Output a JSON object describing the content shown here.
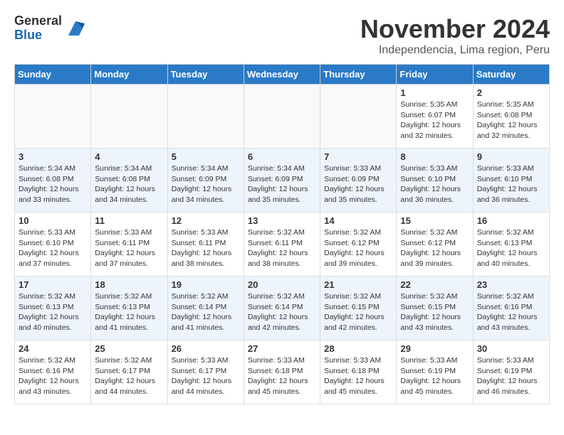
{
  "logo": {
    "general": "General",
    "blue": "Blue"
  },
  "title": "November 2024",
  "subtitle": "Independencia, Lima region, Peru",
  "headers": [
    "Sunday",
    "Monday",
    "Tuesday",
    "Wednesday",
    "Thursday",
    "Friday",
    "Saturday"
  ],
  "weeks": [
    {
      "days": [
        {
          "number": "",
          "info": ""
        },
        {
          "number": "",
          "info": ""
        },
        {
          "number": "",
          "info": ""
        },
        {
          "number": "",
          "info": ""
        },
        {
          "number": "",
          "info": ""
        },
        {
          "number": "1",
          "info": "Sunrise: 5:35 AM\nSunset: 6:07 PM\nDaylight: 12 hours and 32 minutes."
        },
        {
          "number": "2",
          "info": "Sunrise: 5:35 AM\nSunset: 6:08 PM\nDaylight: 12 hours and 32 minutes."
        }
      ]
    },
    {
      "days": [
        {
          "number": "3",
          "info": "Sunrise: 5:34 AM\nSunset: 6:08 PM\nDaylight: 12 hours and 33 minutes."
        },
        {
          "number": "4",
          "info": "Sunrise: 5:34 AM\nSunset: 6:08 PM\nDaylight: 12 hours and 34 minutes."
        },
        {
          "number": "5",
          "info": "Sunrise: 5:34 AM\nSunset: 6:09 PM\nDaylight: 12 hours and 34 minutes."
        },
        {
          "number": "6",
          "info": "Sunrise: 5:34 AM\nSunset: 6:09 PM\nDaylight: 12 hours and 35 minutes."
        },
        {
          "number": "7",
          "info": "Sunrise: 5:33 AM\nSunset: 6:09 PM\nDaylight: 12 hours and 35 minutes."
        },
        {
          "number": "8",
          "info": "Sunrise: 5:33 AM\nSunset: 6:10 PM\nDaylight: 12 hours and 36 minutes."
        },
        {
          "number": "9",
          "info": "Sunrise: 5:33 AM\nSunset: 6:10 PM\nDaylight: 12 hours and 36 minutes."
        }
      ]
    },
    {
      "days": [
        {
          "number": "10",
          "info": "Sunrise: 5:33 AM\nSunset: 6:10 PM\nDaylight: 12 hours and 37 minutes."
        },
        {
          "number": "11",
          "info": "Sunrise: 5:33 AM\nSunset: 6:11 PM\nDaylight: 12 hours and 37 minutes."
        },
        {
          "number": "12",
          "info": "Sunrise: 5:33 AM\nSunset: 6:11 PM\nDaylight: 12 hours and 38 minutes."
        },
        {
          "number": "13",
          "info": "Sunrise: 5:32 AM\nSunset: 6:11 PM\nDaylight: 12 hours and 38 minutes."
        },
        {
          "number": "14",
          "info": "Sunrise: 5:32 AM\nSunset: 6:12 PM\nDaylight: 12 hours and 39 minutes."
        },
        {
          "number": "15",
          "info": "Sunrise: 5:32 AM\nSunset: 6:12 PM\nDaylight: 12 hours and 39 minutes."
        },
        {
          "number": "16",
          "info": "Sunrise: 5:32 AM\nSunset: 6:13 PM\nDaylight: 12 hours and 40 minutes."
        }
      ]
    },
    {
      "days": [
        {
          "number": "17",
          "info": "Sunrise: 5:32 AM\nSunset: 6:13 PM\nDaylight: 12 hours and 40 minutes."
        },
        {
          "number": "18",
          "info": "Sunrise: 5:32 AM\nSunset: 6:13 PM\nDaylight: 12 hours and 41 minutes."
        },
        {
          "number": "19",
          "info": "Sunrise: 5:32 AM\nSunset: 6:14 PM\nDaylight: 12 hours and 41 minutes."
        },
        {
          "number": "20",
          "info": "Sunrise: 5:32 AM\nSunset: 6:14 PM\nDaylight: 12 hours and 42 minutes."
        },
        {
          "number": "21",
          "info": "Sunrise: 5:32 AM\nSunset: 6:15 PM\nDaylight: 12 hours and 42 minutes."
        },
        {
          "number": "22",
          "info": "Sunrise: 5:32 AM\nSunset: 6:15 PM\nDaylight: 12 hours and 43 minutes."
        },
        {
          "number": "23",
          "info": "Sunrise: 5:32 AM\nSunset: 6:16 PM\nDaylight: 12 hours and 43 minutes."
        }
      ]
    },
    {
      "days": [
        {
          "number": "24",
          "info": "Sunrise: 5:32 AM\nSunset: 6:16 PM\nDaylight: 12 hours and 43 minutes."
        },
        {
          "number": "25",
          "info": "Sunrise: 5:32 AM\nSunset: 6:17 PM\nDaylight: 12 hours and 44 minutes."
        },
        {
          "number": "26",
          "info": "Sunrise: 5:33 AM\nSunset: 6:17 PM\nDaylight: 12 hours and 44 minutes."
        },
        {
          "number": "27",
          "info": "Sunrise: 5:33 AM\nSunset: 6:18 PM\nDaylight: 12 hours and 45 minutes."
        },
        {
          "number": "28",
          "info": "Sunrise: 5:33 AM\nSunset: 6:18 PM\nDaylight: 12 hours and 45 minutes."
        },
        {
          "number": "29",
          "info": "Sunrise: 5:33 AM\nSunset: 6:19 PM\nDaylight: 12 hours and 45 minutes."
        },
        {
          "number": "30",
          "info": "Sunrise: 5:33 AM\nSunset: 6:19 PM\nDaylight: 12 hours and 46 minutes."
        }
      ]
    }
  ]
}
